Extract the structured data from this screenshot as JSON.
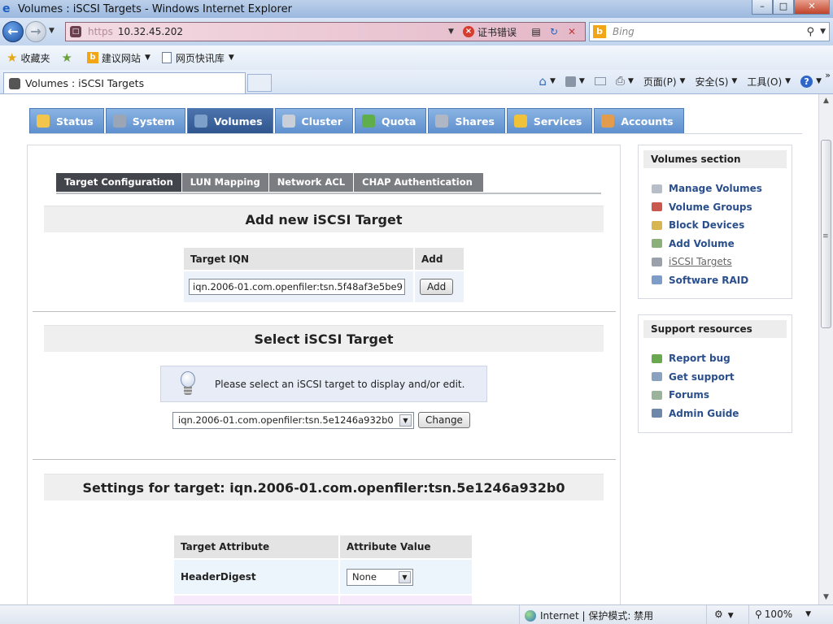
{
  "window": {
    "title": "Volumes : iSCSI Targets - Windows Internet Explorer",
    "minimize": "–",
    "maximize": "□",
    "close": "✕"
  },
  "address_bar": {
    "scheme": "https",
    "host": "10.32.45.202",
    "cert_error": "证书错误",
    "search_placeholder": "Bing"
  },
  "favorites_bar": {
    "favorites_label": "收藏夹",
    "suggested_sites": "建议网站",
    "web_slice": "网页快讯库"
  },
  "tab": {
    "title": "Volumes : iSCSI Targets"
  },
  "command_bar": {
    "page_menu": "页面(P)",
    "safety_menu": "安全(S)",
    "tools_menu": "工具(O)",
    "help": "?",
    "overflow": "»"
  },
  "main_nav": {
    "items": [
      {
        "label": "Status",
        "active": false,
        "color": "#f2c64c"
      },
      {
        "label": "System",
        "active": false,
        "color": "#9aa6b5"
      },
      {
        "label": "Volumes",
        "active": true,
        "color": "#7ca0c9"
      },
      {
        "label": "Cluster",
        "active": false,
        "color": "#c9cfd8"
      },
      {
        "label": "Quota",
        "active": false,
        "color": "#5fae4b"
      },
      {
        "label": "Shares",
        "active": false,
        "color": "#aeb7c3"
      },
      {
        "label": "Services",
        "active": false,
        "color": "#f0c23a"
      },
      {
        "label": "Accounts",
        "active": false,
        "color": "#e39b4c"
      }
    ]
  },
  "sub_tabs": {
    "items": [
      {
        "label": "Target Configuration",
        "active": true
      },
      {
        "label": "LUN Mapping",
        "active": false
      },
      {
        "label": "Network ACL",
        "active": false
      },
      {
        "label": "CHAP Authentication",
        "active": false
      }
    ]
  },
  "add_target": {
    "heading": "Add new iSCSI Target",
    "col_iqn": "Target IQN",
    "col_add": "Add",
    "iqn_value": "iqn.2006-01.com.openfiler:tsn.5f48af3e5be9",
    "add_button": "Add"
  },
  "select_target": {
    "heading": "Select iSCSI Target",
    "info_text": "Please select an iSCSI target to display and/or edit.",
    "selected_target": "iqn.2006-01.com.openfiler:tsn.5e1246a932b0",
    "change_button": "Change"
  },
  "settings": {
    "heading": "Settings for target: iqn.2006-01.com.openfiler:tsn.5e1246a932b0",
    "col_attribute": "Target Attribute",
    "col_value": "Attribute Value",
    "rows": [
      {
        "attribute": "HeaderDigest",
        "value": "None"
      }
    ]
  },
  "sidebar": {
    "volumes_title": "Volumes section",
    "volumes_items": [
      {
        "label": "Manage Volumes",
        "current": false,
        "color": "#b8bec8"
      },
      {
        "label": "Volume Groups",
        "current": false,
        "color": "#c9584e"
      },
      {
        "label": "Block Devices",
        "current": false,
        "color": "#d7b652"
      },
      {
        "label": "Add Volume",
        "current": false,
        "color": "#8bb07a"
      },
      {
        "label": "iSCSI Targets",
        "current": true,
        "color": "#9aa1ab"
      },
      {
        "label": "Software RAID",
        "current": false,
        "color": "#7d9cc7"
      }
    ],
    "support_title": "Support resources",
    "support_items": [
      {
        "label": "Report bug",
        "color": "#6aa84f"
      },
      {
        "label": "Get support",
        "color": "#8aa1c0"
      },
      {
        "label": "Forums",
        "color": "#9bb39a"
      },
      {
        "label": "Admin Guide",
        "color": "#6f87a8"
      }
    ]
  },
  "status_bar": {
    "zone": "Internet | 保护模式: 禁用",
    "zoom": "100%"
  }
}
